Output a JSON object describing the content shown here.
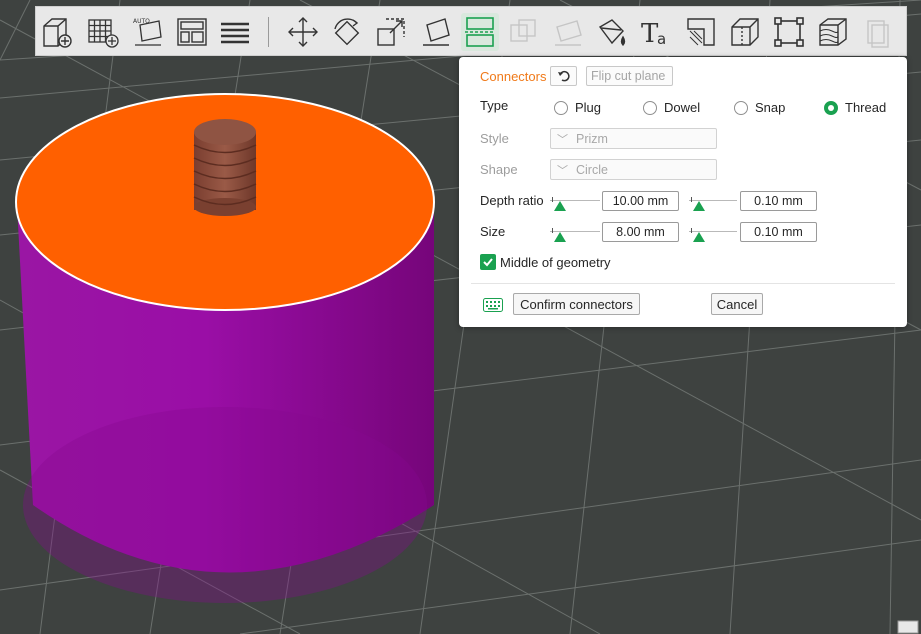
{
  "panel": {
    "connectors_label": "Connectors",
    "flip_cut_plane_label": "Flip cut plane",
    "type_label": "Type",
    "type_options": [
      "Plug",
      "Dowel",
      "Snap",
      "Thread"
    ],
    "type_selected": "Thread",
    "style_label": "Style",
    "style_value": "Prizm",
    "shape_label": "Shape",
    "shape_value": "Circle",
    "depth_ratio_label": "Depth ratio",
    "depth_ratio_value": "10.00  mm",
    "depth_ratio_tolerance": "0.10  mm",
    "size_label": "Size",
    "size_value": "8.00  mm",
    "size_tolerance": "0.10  mm",
    "middle_of_geometry_label": "Middle of geometry",
    "middle_of_geometry_checked": true,
    "confirm_label": "Confirm connectors",
    "cancel_label": "Cancel"
  },
  "toolbar": {
    "tools": [
      "add-object",
      "add-plate",
      "auto-orient",
      "arrange",
      "split-layers",
      "move",
      "rotate",
      "scale",
      "lay-on-face",
      "cut",
      "boolean",
      "seam",
      "paint-bucket",
      "text",
      "variable-layer-height",
      "support-painting",
      "measure",
      "assemble",
      "slice-view",
      "more"
    ],
    "active_tool": "cut"
  },
  "colors": {
    "accent": "#1aa150",
    "connectors_label": "#f07a1a",
    "cut_surface": "#ff6000",
    "object_body": "#8c0a96",
    "connector": "#8a4a38",
    "bed": "#3e4240"
  }
}
